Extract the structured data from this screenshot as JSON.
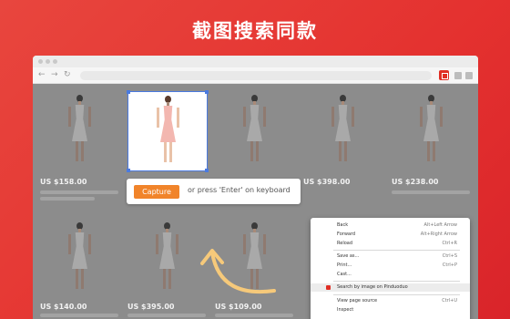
{
  "headline": "截图搜索同款",
  "browser": {
    "nav": {
      "back": "←",
      "forward": "→",
      "reload": "↻"
    }
  },
  "products": [
    {
      "price": "US $158.00"
    },
    {
      "price": ""
    },
    {
      "price": ""
    },
    {
      "price": "US $398.00"
    },
    {
      "price": "US $238.00"
    },
    {
      "price": "US $140.00"
    },
    {
      "price": "US $395.00"
    },
    {
      "price": "US $109.00"
    },
    {
      "price": ""
    },
    {
      "price": ""
    }
  ],
  "capture": {
    "button_label": "Capture",
    "hint": "or press 'Enter' on keyboard"
  },
  "context_menu": {
    "items": [
      {
        "label": "Back",
        "shortcut": "Alt+Left Arrow"
      },
      {
        "label": "Forward",
        "shortcut": "Alt+Right Arrow"
      },
      {
        "label": "Reload",
        "shortcut": "Ctrl+R"
      },
      {
        "label": "Save as...",
        "shortcut": "Ctrl+S"
      },
      {
        "label": "Print...",
        "shortcut": "Ctrl+P"
      },
      {
        "label": "Cast...",
        "shortcut": ""
      },
      {
        "label": "Search by image on Pinduoduo",
        "shortcut": ""
      },
      {
        "label": "View page source",
        "shortcut": "Ctrl+U"
      },
      {
        "label": "Inspect",
        "shortcut": ""
      }
    ]
  },
  "colors": {
    "brand_red": "#e4312f",
    "capture_orange": "#f1842a",
    "arrow_yellow": "#f6c97a",
    "selection_blue": "#4a7ae0"
  }
}
